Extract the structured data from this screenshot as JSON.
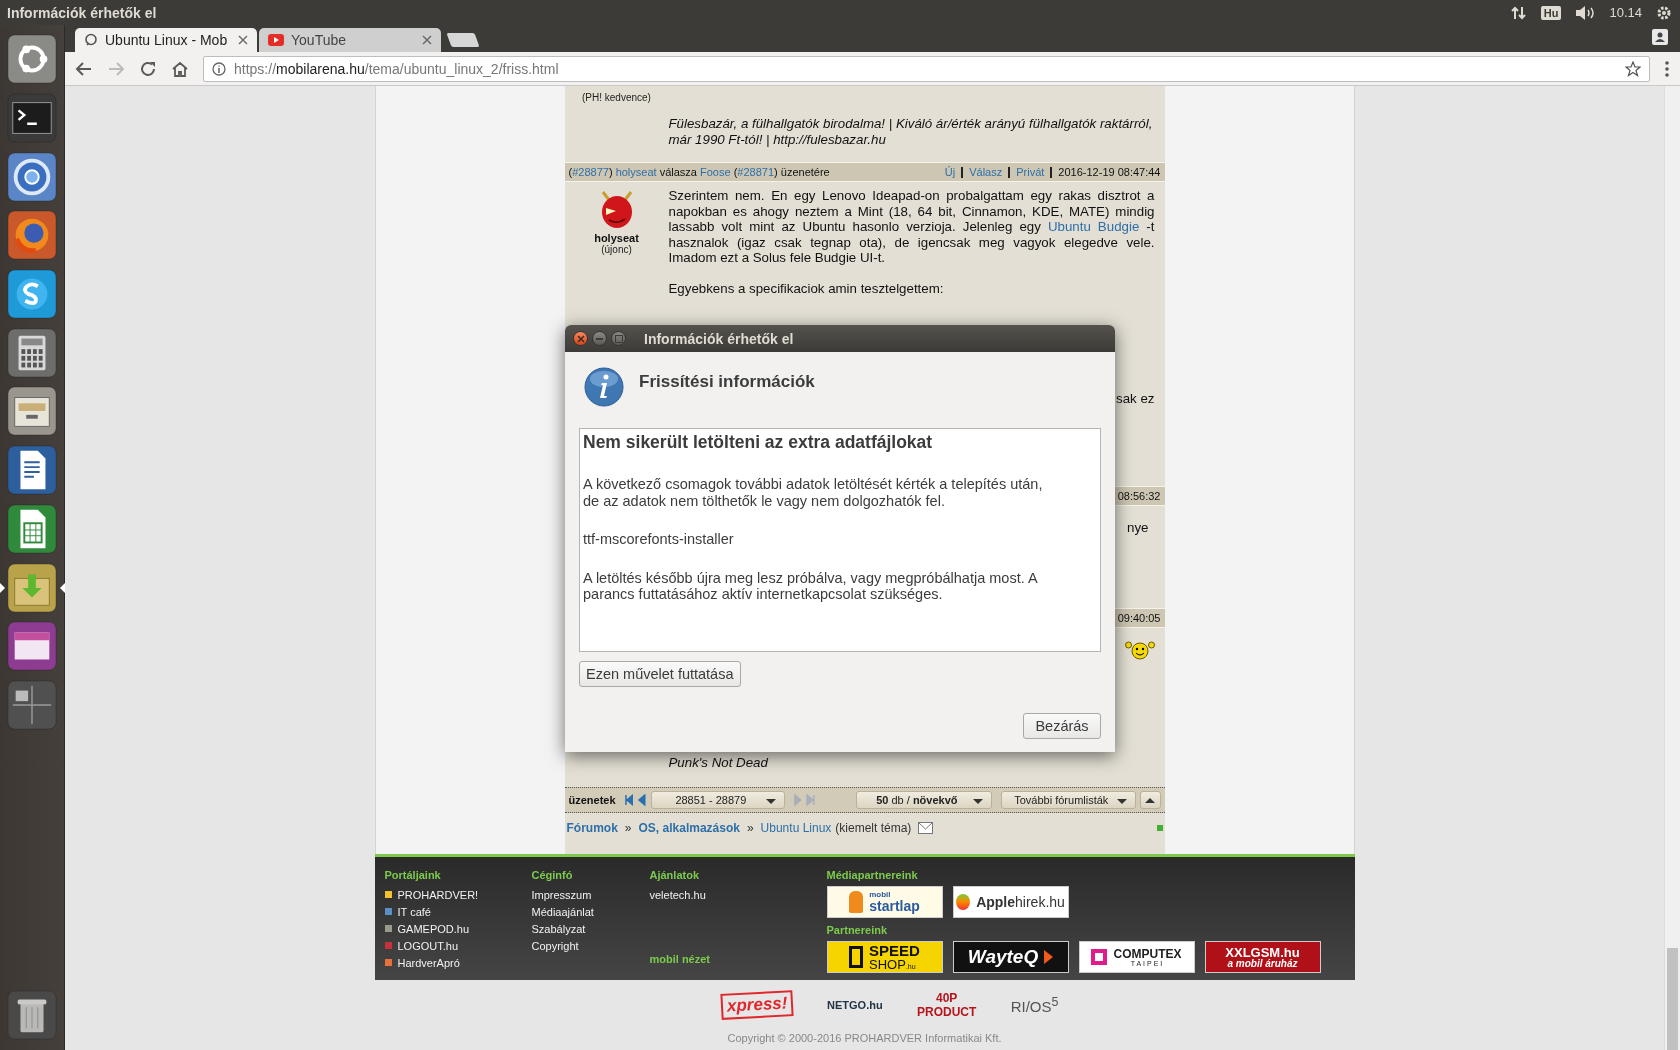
{
  "panel": {
    "title": "Információk érhetők el",
    "keyboard": "Hu",
    "clock": "10.14"
  },
  "launcher": [
    {
      "kind": "dash",
      "focused": false
    },
    {
      "kind": "terminal",
      "focused": false
    },
    {
      "kind": "chromium",
      "focused": false
    },
    {
      "kind": "firefox",
      "focused": false
    },
    {
      "kind": "chat",
      "focused": false
    },
    {
      "kind": "calculator",
      "focused": false
    },
    {
      "kind": "files",
      "focused": false
    },
    {
      "kind": "writer",
      "focused": false
    },
    {
      "kind": "spreadsheet",
      "focused": false
    },
    {
      "kind": "installer",
      "focused": true
    },
    {
      "kind": "purple",
      "focused": false
    },
    {
      "kind": "workspaces",
      "focused": false
    },
    {
      "kind": "trash",
      "focused": false
    }
  ],
  "browser": {
    "tabs": [
      {
        "title": "Ubuntu Linux - Mob",
        "kind": "forum",
        "selected": true
      },
      {
        "title": "YouTube",
        "kind": "video",
        "selected": false
      }
    ],
    "url": {
      "scheme": "https://",
      "host": "mobilarena.hu",
      "path": "/tema/ubuntu_linux_2/friss.html"
    }
  },
  "forum": {
    "tail": {
      "rank": "(PH! kedvence)",
      "signature": "Fülesbazár, a fülhallgatók birodalma! | Kiváló ár/érték arányú fülhallgatók raktárról, már 1990 Ft-tól! | http://fulesbazar.hu"
    },
    "post": {
      "header": [
        {
          "text": "(",
          "link": false
        },
        {
          "text": "#28877",
          "link": true
        },
        {
          "text": ") ",
          "link": false
        },
        {
          "text": "holyseat",
          "link": true
        },
        {
          "text": " válasza ",
          "link": false
        },
        {
          "text": "Foose",
          "link": true
        },
        {
          "text": " (",
          "link": false
        },
        {
          "text": "#28871",
          "link": true
        },
        {
          "text": ") üzenetére",
          "link": false
        }
      ],
      "actions": [
        "Új",
        "Válasz",
        "Privát"
      ],
      "date": "2016-12-19 08:47:44",
      "user": {
        "name": "holyseat",
        "rank": "(újonc)"
      },
      "intro": {
        "before": "Szerintem nem. En egy Lenovo Ideapad-on probalgattam egy rakas disztrot a napokban es ahogy neztem a Mint (18, 64 bit, Cinnamon, KDE, MATE) mindig lassabb volt mint az Ubuntu hasonlo verzioja. Jelenleg egy ",
        "link": "Ubuntu Budgie",
        "after": " -t hasznalok (igaz csak tegnap ota), de igencsak meg vagyok elegedve vele. Imadom ezt a Solus fele Budgie UI-t."
      },
      "paragraph": "Egyebkens a specifikaciok amin tesztelgettem:",
      "fragment": "sak  ez"
    },
    "covered": [
      {
        "time": "08:56:32",
        "fragment": "nye"
      },
      {
        "time": "09:40:05",
        "smiley": true,
        "signature": "Punk's Not Dead"
      }
    ],
    "nav": {
      "label": "üzenetek",
      "range": "28851 - 28879",
      "per_page": "**50** db / **növekvő**",
      "more": "További fórumlisták",
      "arrows": [
        {
          "kind": "first",
          "disabled": false
        },
        {
          "kind": "prev",
          "disabled": false
        },
        {
          "kind": "next",
          "disabled": true
        },
        {
          "kind": "last",
          "disabled": true
        }
      ]
    },
    "breadcrumb": [
      {
        "text": "Fórumok",
        "kind": "strong"
      },
      {
        "text": "»",
        "kind": "sep"
      },
      {
        "text": "OS, alkalmazások",
        "kind": "strong"
      },
      {
        "text": "»",
        "kind": "sep"
      },
      {
        "text": "Ubuntu Linux",
        "kind": "link"
      },
      {
        "text": "(kiemelt téma)",
        "kind": "note"
      }
    ]
  },
  "dialog": {
    "title": "Információk érhetők el",
    "heading": "Frissítési információk",
    "box_title": "Nem sikerült letölteni az extra adatfájlokat",
    "paragraphs": [
      "A következő csomagok további adatok letöltését kérték a telepítés után, de az adatok nem tölthetők le vagy nem dolgozhatók fel.",
      "ttf-mscorefonts-installer",
      "A letöltés később újra meg lesz próbálva, vagy megpróbálhatja most. A parancs futtatásához aktív internetkapcsolat szükséges."
    ],
    "run_button": "Ezen művelet futtatása",
    "close_button": "Bezárás"
  },
  "footer": {
    "portals": {
      "title": "Portáljaink",
      "items": [
        {
          "label": "PROHARDVER!",
          "color": "#f2c230"
        },
        {
          "label": "IT café",
          "color": "#5b8fc7"
        },
        {
          "label": "GAMEPOD.hu",
          "color": "#9a9a8a"
        },
        {
          "label": "LOGOUT.hu",
          "color": "#c8303a"
        },
        {
          "label": "HardverApró",
          "color": "#e8703a"
        }
      ]
    },
    "company": {
      "title": "Céginfó",
      "items": [
        "Impresszum",
        "Médiaajánlat",
        "Szabályzat",
        "Copyright"
      ]
    },
    "offers": {
      "title": "Ajánlatok",
      "items": [
        "veletech.hu"
      ],
      "mobile": "mobil nézet"
    },
    "media": {
      "title": "Médiapartnereink",
      "logos": [
        {
          "kind": "startlap",
          "lines": [
            "mobil",
            "startlap"
          ]
        },
        {
          "kind": "apple",
          "text": "**Apple**hirek.hu"
        }
      ]
    },
    "partners": {
      "title": "Partnereink",
      "logos": [
        {
          "kind": "speed",
          "lines": [
            "SPEED",
            "SHOP",
            ".hu"
          ]
        },
        {
          "kind": "wayteq",
          "lines": [
            "WayteQ"
          ]
        },
        {
          "kind": "computex",
          "lines": [
            "COMPUTEX",
            "TAIPEI"
          ]
        },
        {
          "kind": "xxlgsm",
          "lines": [
            "XXLGSM.hu",
            "a mobil áruház"
          ]
        }
      ]
    },
    "bottom_logos": [
      {
        "kind": "xpress",
        "text": "xpress!"
      },
      {
        "kind": "netgo",
        "text": "NETGO.hu"
      },
      {
        "kind": "product",
        "text": "40P PRODUCT"
      },
      {
        "kind": "rios",
        "text": "RI/OS$^{5}$"
      }
    ],
    "copyright": "Copyright © 2000-2016 PROHARDVER Informatikai Kft."
  }
}
